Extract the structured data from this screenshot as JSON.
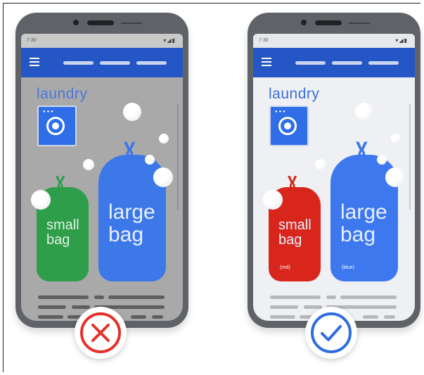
{
  "examples": [
    {
      "id": "incorrect",
      "status_time": "7:30",
      "status_icons": "▾◢▮",
      "title": "laundry",
      "small_bag": {
        "line1": "small",
        "line2": "bag",
        "tag": ""
      },
      "large_bag": {
        "line1": "large",
        "line2": "bag",
        "tag": ""
      },
      "bag_colors": {
        "small": "#2e9e4a",
        "large": "#3d78e8"
      },
      "verdict_icon": "cross-icon",
      "verdict_color": "#e3322b"
    },
    {
      "id": "correct",
      "status_time": "7:30",
      "status_icons": "▾◢▮",
      "title": "laundry",
      "small_bag": {
        "line1": "small",
        "line2": "bag",
        "tag": "(red)"
      },
      "large_bag": {
        "line1": "large",
        "line2": "bag",
        "tag": "(blue)"
      },
      "bag_colors": {
        "small": "#d9261c",
        "large": "#3d78ef"
      },
      "verdict_icon": "checkmark-icon",
      "verdict_color": "#2f6de0"
    }
  ],
  "accent": "#2457c5"
}
